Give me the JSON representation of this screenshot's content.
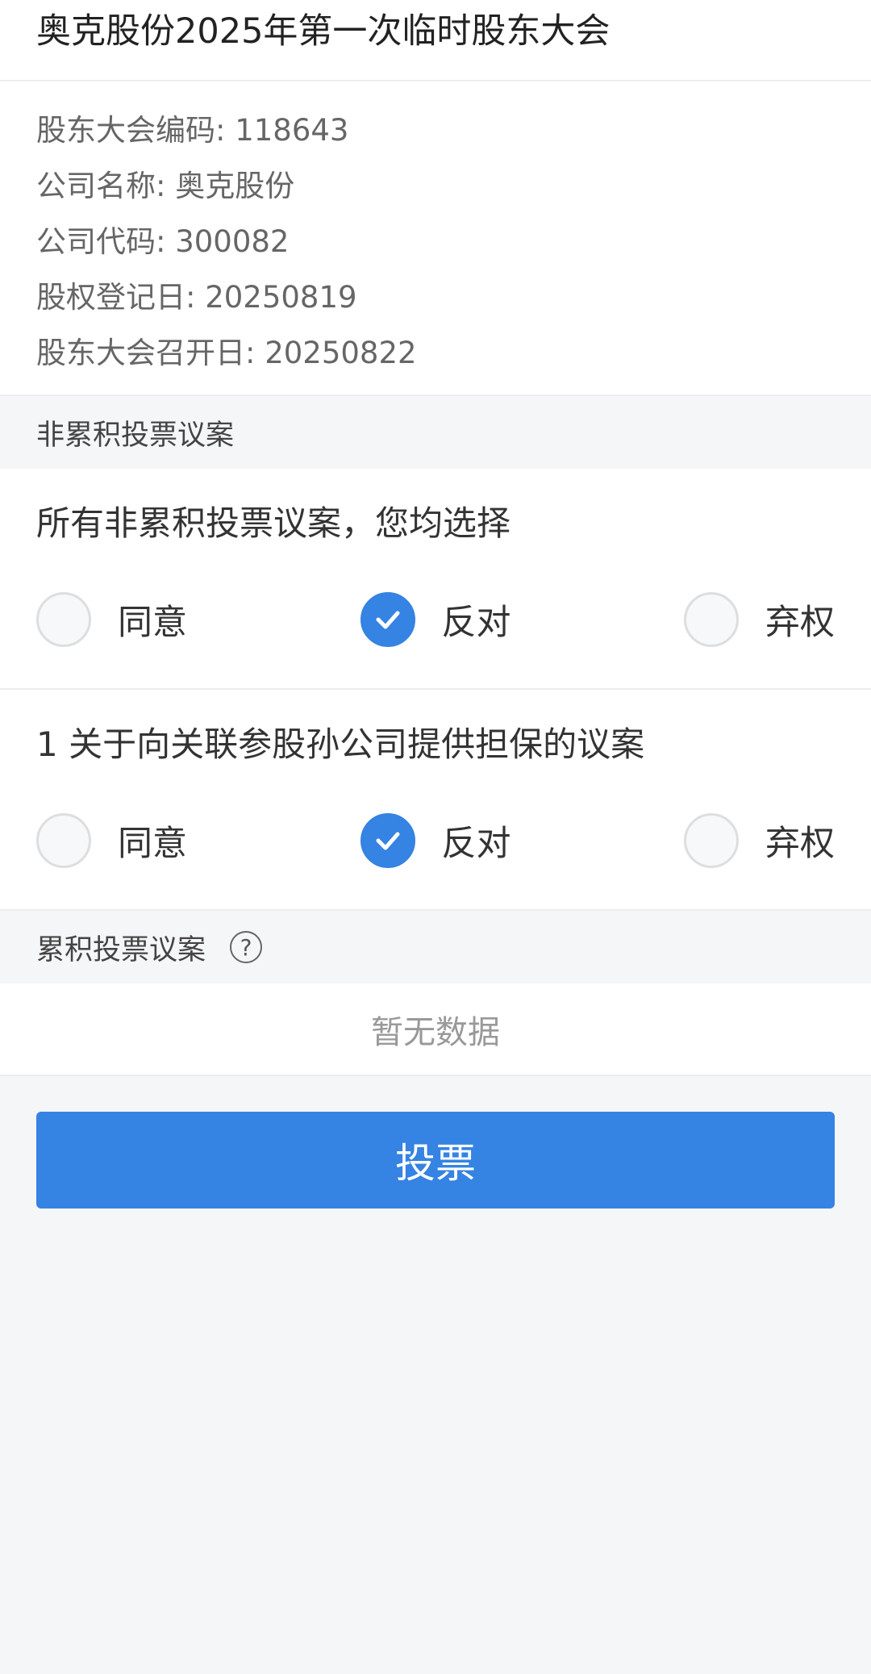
{
  "header": {
    "title": "奥克股份2025年第一次临时股东大会"
  },
  "info": {
    "rows": [
      "股东大会编码: 118643",
      "公司名称: 奥克股份",
      "公司代码: 300082",
      "股权登记日: 20250819",
      "股东大会召开日: 20250822"
    ]
  },
  "non_cumulative": {
    "section_title": "非累积投票议案",
    "proposals": [
      {
        "title": "所有非累积投票议案，您均选择",
        "options": [
          "同意",
          "反对",
          "弃权"
        ],
        "selected": "反对"
      },
      {
        "title": "1 关于向关联参股孙公司提供担保的议案",
        "options": [
          "同意",
          "反对",
          "弃权"
        ],
        "selected": "反对"
      }
    ]
  },
  "cumulative": {
    "section_title": "累积投票议案",
    "help_icon": "question-circle-icon",
    "empty_text": "暂无数据"
  },
  "vote_button": {
    "label": "投票"
  },
  "colors": {
    "accent": "#3583e2",
    "background": "#f5f6f8"
  }
}
